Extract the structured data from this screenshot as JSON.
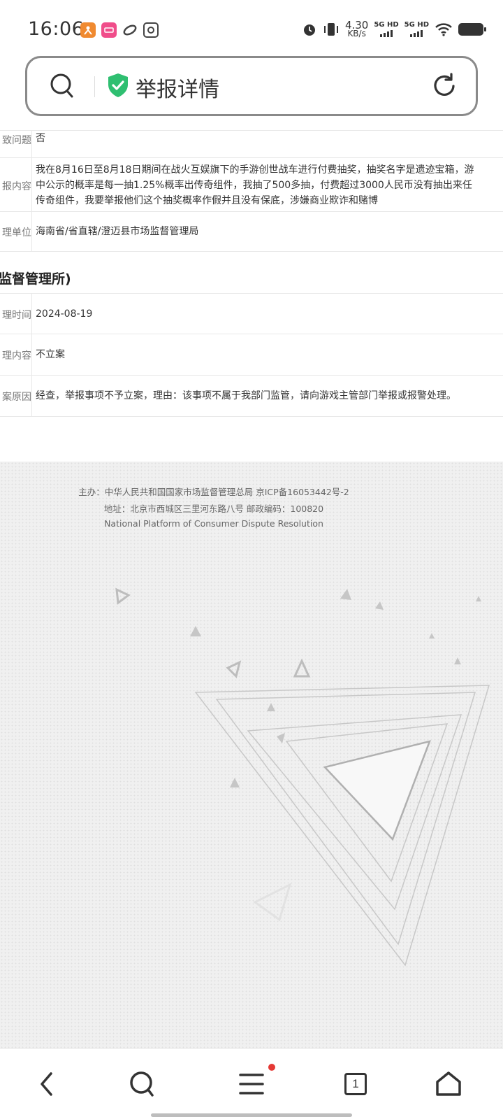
{
  "status_bar": {
    "time": "16:06",
    "net_speed_value": "4.30",
    "net_speed_unit": "KB/s",
    "signal1_label": "5G HD",
    "signal2_label": "5G HD"
  },
  "search_bar": {
    "title": "举报详情"
  },
  "details": {
    "rows": [
      {
        "label": "致问题",
        "value": "否"
      },
      {
        "label": "报内容",
        "lines": [
          "我在8月16日至8月18日期间在战火互娱旗下的手游创世战车进行付费抽奖，抽奖名字是遗迹宝箱，游",
          "中公示的概率是每一抽1.25%概率出传奇组件，我抽了500多抽，付费超过3000人民币没有抽出来任",
          "传奇组件，我要举报他们这个抽奖概率作假并且没有保底，涉嫌商业欺诈和赌博"
        ]
      },
      {
        "label": "理单位",
        "value": "海南省/省直辖/澄迈县市场监督管理局"
      }
    ],
    "section_title": "监督管理所)",
    "result_rows": [
      {
        "label": "理时间",
        "value": "2024-08-19"
      },
      {
        "label": "理内容",
        "value": "不立案"
      },
      {
        "label": "案原因",
        "value": "经查，举报事项不予立案，理由：该事项不属于我部门监管，请向游戏主管部门举报或报警处理。"
      }
    ]
  },
  "footer": {
    "host_line": "主办：中华人民共和国国家市场监督管理总局 京ICP备16053442号-2",
    "address_line": "地址：北京市西城区三里河东路八号 邮政编码：100820",
    "platform_name": "National Platform of Consumer Dispute Resolution"
  },
  "bottom_nav": {
    "tab_count": "1"
  },
  "colors": {
    "accent_green": "#2fbf71",
    "notification_red": "#e53935"
  }
}
